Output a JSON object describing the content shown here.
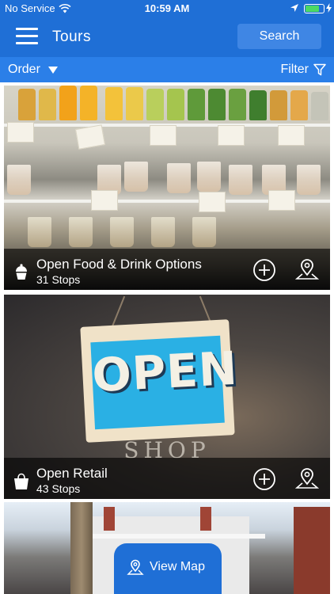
{
  "status_bar": {
    "carrier": "No Service",
    "time": "10:59 AM",
    "battery_level": 0.8,
    "wifi_icon": "wifi-icon",
    "location_icon": "location-arrow-icon",
    "battery_icon": "battery-charging-icon"
  },
  "nav": {
    "title": "Tours",
    "search_label": "Search",
    "menu_icon": "hamburger-menu-icon"
  },
  "filter_bar": {
    "order_label": "Order",
    "filter_label": "Filter"
  },
  "tours": [
    {
      "title": "Open Food & Drink Options",
      "stops": "31 Stops",
      "icon": "cupcake-icon"
    },
    {
      "title": "Open Retail",
      "stops": "43 Stops",
      "icon": "shopping-bag-icon"
    }
  ],
  "view_map": {
    "label": "View Map",
    "icon": "map-pin-icon"
  },
  "colors": {
    "primary": "#1f6fd6",
    "filter_bar": "#2b7fe8",
    "search_button": "#3f86e4",
    "battery_fill": "#4cd964"
  }
}
